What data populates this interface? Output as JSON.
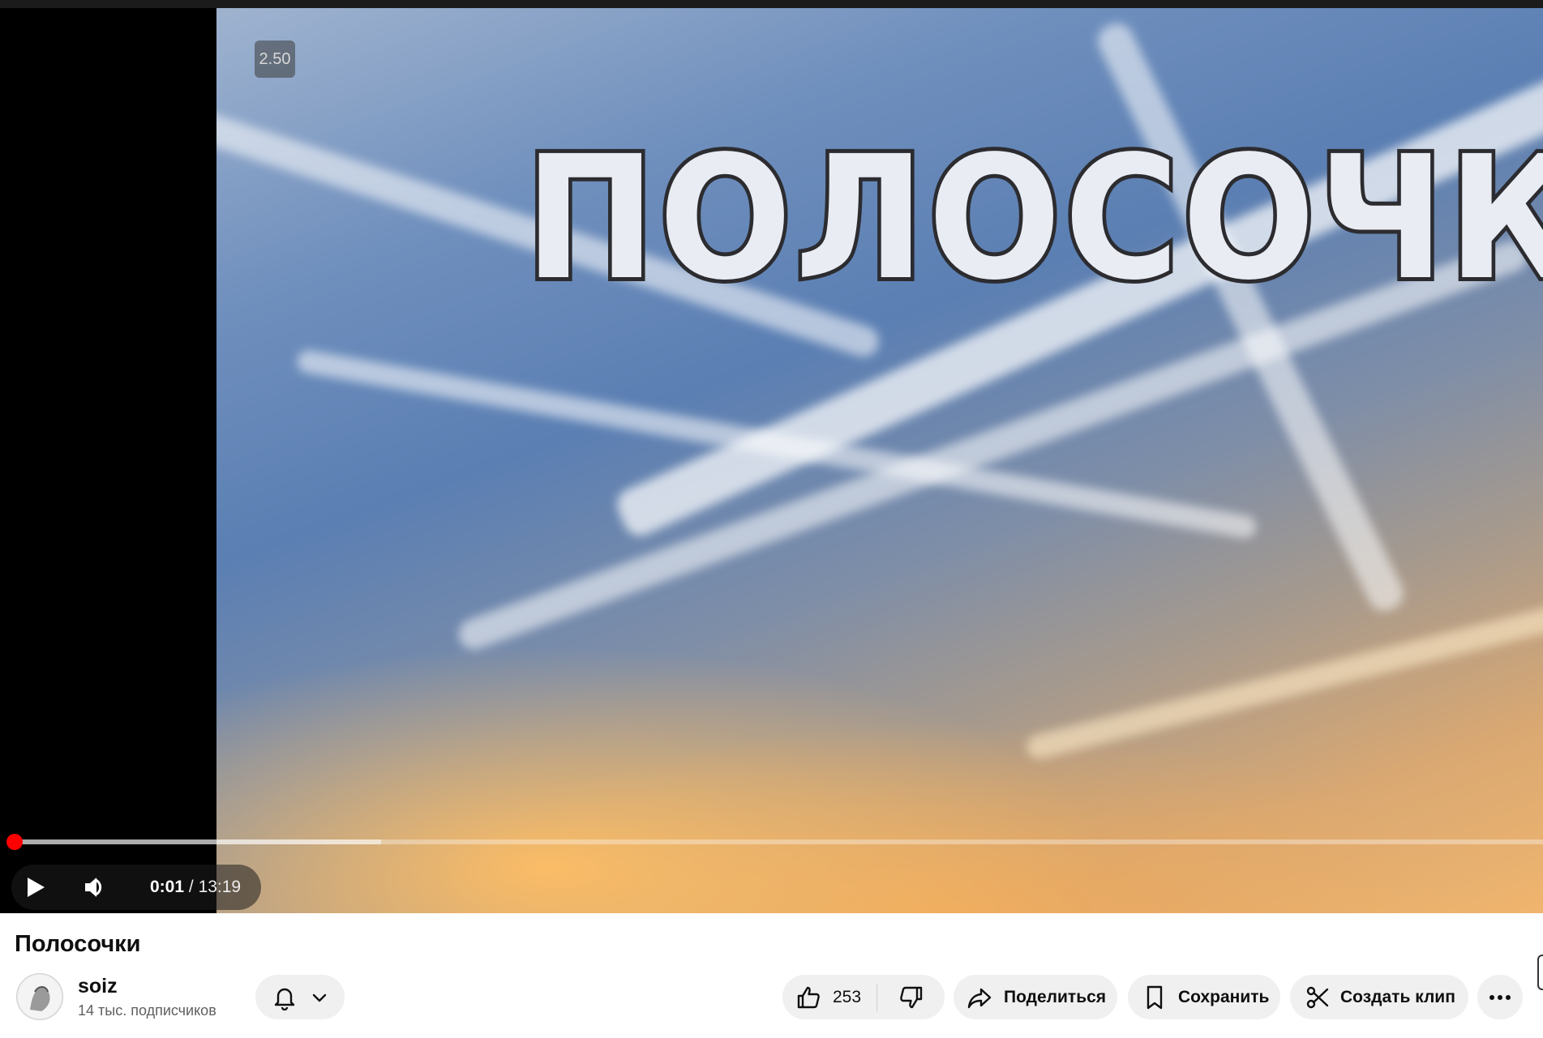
{
  "video": {
    "overlay_title": "полосочки",
    "speed_badge": "2.50",
    "time_current": "0:01",
    "time_separator": "/",
    "time_duration": "13:19",
    "progress_played_fraction": 0.001,
    "progress_buffered_fraction": 0.24
  },
  "details": {
    "title": "Полосочки",
    "channel_name": "soiz",
    "subscribers": "14 тыс. подписчиков",
    "likes": "253",
    "share_label": "Поделиться",
    "save_label": "Сохранить",
    "clip_label": "Создать клип"
  },
  "icons": {
    "play": "play-icon",
    "volume": "volume-icon",
    "bell": "bell-icon",
    "chevron": "chevron-down-icon",
    "like": "thumbs-up-icon",
    "dislike": "thumbs-down-icon",
    "share": "share-arrow-icon",
    "save": "bookmark-icon",
    "clip": "scissors-icon",
    "more": "more-dots-icon"
  },
  "colors": {
    "progress_red": "#ff0000",
    "pill_bg": "#f0f0f0",
    "text_primary": "#0f0f0f",
    "text_secondary": "#606060"
  }
}
